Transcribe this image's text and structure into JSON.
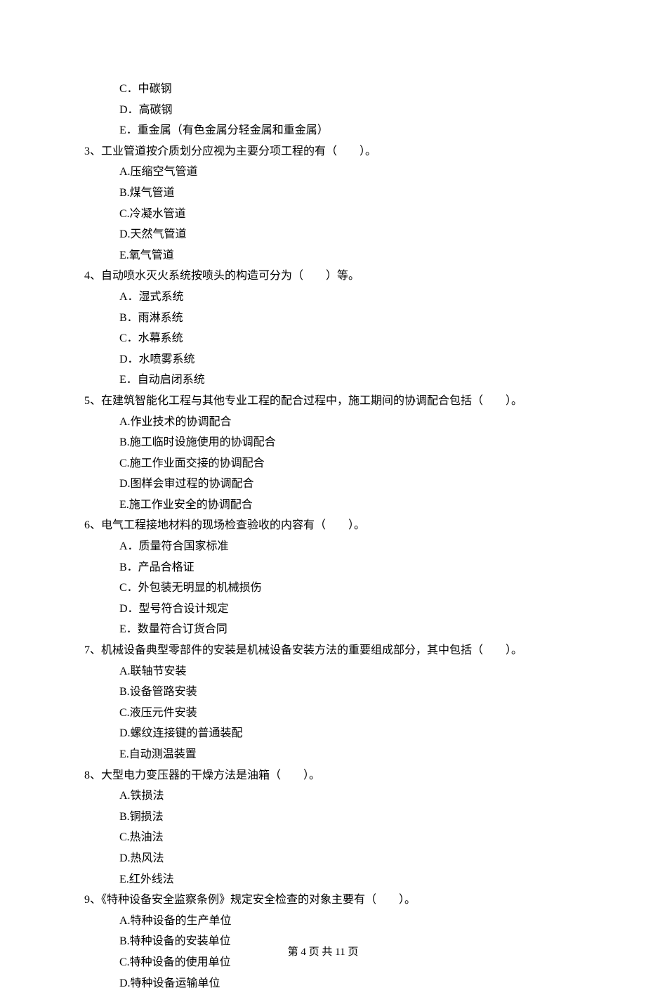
{
  "preOptions": {
    "c": "C．中碳钢",
    "d": "D．高碳钢",
    "e": "E．重金属（有色金属分轻金属和重金属）"
  },
  "q3": {
    "text": "3、工业管道按介质划分应视为主要分项工程的有（　　）。",
    "a": "A.压缩空气管道",
    "b": "B.煤气管道",
    "c": "C.冷凝水管道",
    "d": "D.天然气管道",
    "e": "E.氧气管道"
  },
  "q4": {
    "text": "4、自动喷水灭火系统按喷头的构造可分为（　　）等。",
    "a": "A．湿式系统",
    "b": "B．雨淋系统",
    "c": "C．水幕系统",
    "d": "D．水喷雾系统",
    "e": "E．自动启闭系统"
  },
  "q5": {
    "text": "5、在建筑智能化工程与其他专业工程的配合过程中，施工期间的协调配合包括（　　）。",
    "a": "A.作业技术的协调配合",
    "b": "B.施工临时设施使用的协调配合",
    "c": "C.施工作业面交接的协调配合",
    "d": "D.图样会审过程的协调配合",
    "e": "E.施工作业安全的协调配合"
  },
  "q6": {
    "text": "6、电气工程接地材料的现场检查验收的内容有（　　）。",
    "a": "A．质量符合国家标准",
    "b": "B．产品合格证",
    "c": "C．外包装无明显的机械损伤",
    "d": "D．型号符合设计规定",
    "e": "E．数量符合订货合同"
  },
  "q7": {
    "text": "7、机械设备典型零部件的安装是机械设备安装方法的重要组成部分，其中包括（　　）。",
    "a": "A.联轴节安装",
    "b": "B.设备管路安装",
    "c": "C.液压元件安装",
    "d": "D.螺纹连接键的普通装配",
    "e": "E.自动测温装置"
  },
  "q8": {
    "text": "8、大型电力变压器的干燥方法是油箱（　　）。",
    "a": "A.铁损法",
    "b": "B.铜损法",
    "c": "C.热油法",
    "d": "D.热风法",
    "e": "E.红外线法"
  },
  "q9": {
    "text": "9、《特种设备安全监察条例》规定安全检查的对象主要有（　　）。",
    "a": "A.特种设备的生产单位",
    "b": "B.特种设备的安装单位",
    "c": "C.特种设备的使用单位",
    "d": "D.特种设备运输单位"
  },
  "footer": "第 4 页 共 11 页"
}
